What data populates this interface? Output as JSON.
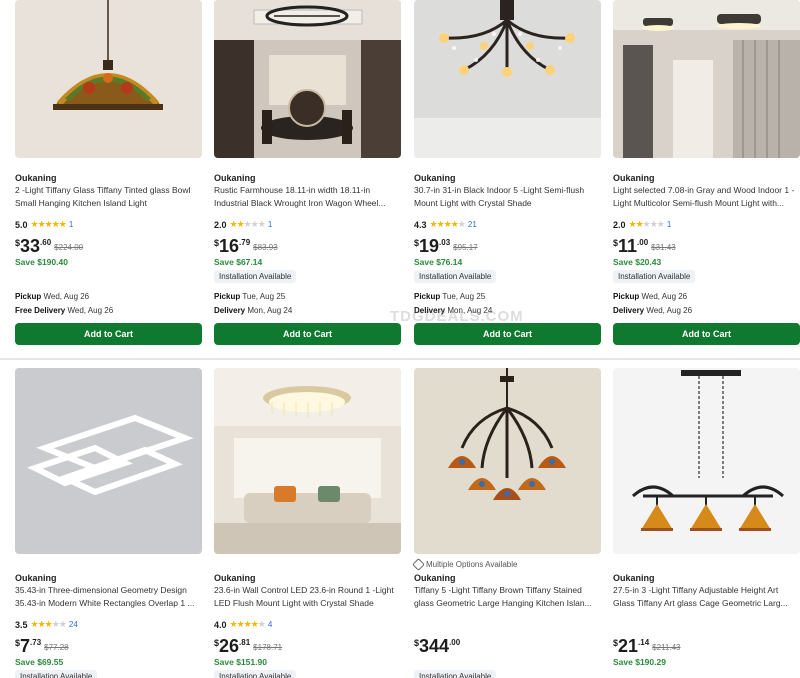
{
  "watermark": "TDGDEALS.COM",
  "add_to_cart_label": "Add to Cart",
  "installation_label": "Installation Available",
  "multi_options_label": "Multiple Options Available",
  "colors": {
    "accent": "#0f7a2f",
    "save_green": "#2a8a3e",
    "star": "#f4b400",
    "link_blue": "#2f6fd6"
  },
  "products": [
    {
      "brand": "Oukaning",
      "title": "2 -Light Tiffany Glass Tiffany Tinted glass Bowl Small Hanging Kitchen Island Light",
      "rating": "5.0",
      "stars": 5,
      "reviews": "1",
      "currency": "$",
      "price_whole": "33",
      "price_cents": ".60",
      "was": "$224.00",
      "save": "Save $190.40",
      "installation": false,
      "pickup_label": "Pickup",
      "pickup_value": "Wed, Aug 26",
      "delivery_label": "Free Delivery",
      "delivery_value": "Wed, Aug 26",
      "image_icon": "tiffany-bowl-pendant"
    },
    {
      "brand": "Oukaning",
      "title": "Rustic Farmhouse 18.11-in width 18.11-in Industrial Black Wrought Iron Wagon Wheel...",
      "rating": "2.0",
      "stars": 2,
      "reviews": "1",
      "currency": "$",
      "price_whole": "16",
      "price_cents": ".79",
      "was": "$83.93",
      "save": "Save $67.14",
      "installation": true,
      "pickup_label": "Pickup",
      "pickup_value": "Tue, Aug 25",
      "delivery_label": "Delivery",
      "delivery_value": "Mon, Aug 24",
      "image_icon": "wagon-wheel-chandelier"
    },
    {
      "brand": "Oukaning",
      "title": "30.7-in 31-in Black Indoor 5 -Light Semi-flush Mount Light with Crystal Shade",
      "rating": "4.3",
      "stars": 4,
      "reviews": "21",
      "currency": "$",
      "price_whole": "19",
      "price_cents": ".03",
      "was": "$95.17",
      "save": "Save $76.14",
      "installation": true,
      "pickup_label": "Pickup",
      "pickup_value": "Tue, Aug 25",
      "delivery_label": "Delivery",
      "delivery_value": "Mon, Aug 24",
      "image_icon": "branch-crystal-light"
    },
    {
      "brand": "Oukaning",
      "title": "Light selected 7.08-in Gray and Wood Indoor 1 -Light Multicolor Semi-flush Mount Light with...",
      "rating": "2.0",
      "stars": 2,
      "reviews": "1",
      "currency": "$",
      "price_whole": "11",
      "price_cents": ".00",
      "was": "$31.43",
      "save": "Save $20.43",
      "installation": true,
      "pickup_label": "Pickup",
      "pickup_value": "Wed, Aug 26",
      "delivery_label": "Delivery",
      "delivery_value": "Wed, Aug 26",
      "image_icon": "flush-mount-hallway"
    },
    {
      "brand": "Oukaning",
      "title": "35.43-in Three-dimensional Geometry Design 35.43-in Modern White Rectangles Overlap 1 ...",
      "rating": "3.5",
      "stars": 3,
      "reviews": "24",
      "currency": "$",
      "price_whole": "7",
      "price_cents": ".73",
      "was": "$77.28",
      "save": "Save $69.55",
      "installation": true,
      "image_icon": "rectangles-led-light"
    },
    {
      "brand": "Oukaning",
      "title": "23.6-in Wall Control LED 23.6-in Round 1 -Light LED Flush Mount Light with Crystal Shade",
      "rating": "4.0",
      "stars": 4,
      "reviews": "4",
      "currency": "$",
      "price_whole": "26",
      "price_cents": ".81",
      "was": "$178.71",
      "save": "Save $151.90",
      "installation": true,
      "image_icon": "round-crystal-flush"
    },
    {
      "brand": "Oukaning",
      "title": "Tiffany 5 -Light Tiffany Brown Tiffany Stained glass Geometric Large Hanging Kitchen Islan...",
      "multi_options": true,
      "currency": "$",
      "price_whole": "344",
      "price_cents": ".00",
      "installation": true,
      "image_icon": "tiffany-five-light-chandelier"
    },
    {
      "brand": "Oukaning",
      "title": "27.5-in 3 -Light Tiffany Adjustable Height Art Glass Tiffany Art glass Cage Geometric Larg...",
      "currency": "$",
      "price_whole": "21",
      "price_cents": ".14",
      "was": "$211.43",
      "save": "Save $190.29",
      "installation": false,
      "image_icon": "tiffany-island-pendant"
    }
  ]
}
